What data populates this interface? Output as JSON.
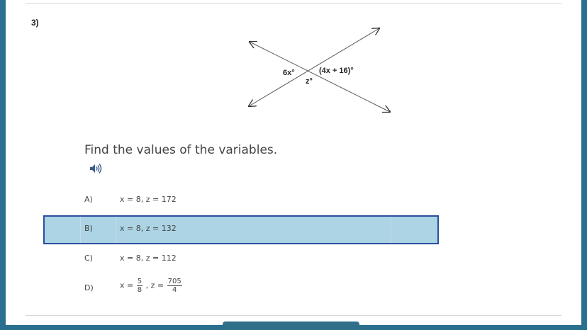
{
  "question": {
    "number": "3)",
    "prompt": "Find the values of the variables."
  },
  "diagram": {
    "labels": {
      "left_angle": "6x°",
      "right_angle": "(4x + 16)°",
      "bottom_angle": "z°"
    }
  },
  "choices": [
    {
      "letter": "A)",
      "text": "x = 8, z = 172",
      "selected": false
    },
    {
      "letter": "B)",
      "text": "x = 8, z = 132",
      "selected": true
    },
    {
      "letter": "C)",
      "text": "x = 8, z = 112",
      "selected": false
    },
    {
      "letter": "D)",
      "x_prefix": "x =",
      "x_num": "5",
      "x_den": "8",
      "z_prefix": ", z =",
      "z_num": "705",
      "z_den": "4",
      "selected": false
    }
  ],
  "icons": {
    "speaker": "speaker-icon"
  },
  "colors": {
    "page_background": "#2a6f8e",
    "selected_fill": "#acd4e4",
    "selected_border": "#2b4f9e"
  }
}
